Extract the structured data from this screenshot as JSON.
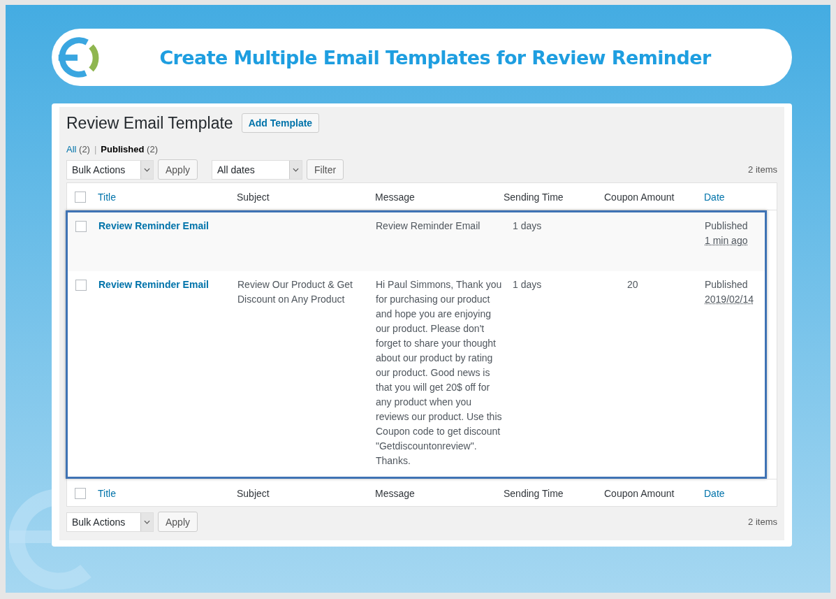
{
  "banner": {
    "title": "Create Multiple Email Templates for Review Reminder"
  },
  "page": {
    "heading": "Review Email Template",
    "add_button": "Add Template"
  },
  "views": [
    {
      "label": "All",
      "count": "(2)",
      "selected": false
    },
    {
      "label": "Published",
      "count": "(2)",
      "selected": true
    }
  ],
  "views_separator": "|",
  "top_nav": {
    "bulk_actions": "Bulk Actions",
    "apply": "Apply",
    "dates": "All dates",
    "filter": "Filter",
    "count": "2 items"
  },
  "table": {
    "rows_highlighted": true,
    "header_checked": false,
    "footer_checked": false,
    "columns": [
      {
        "label": "Title",
        "sortable": true
      },
      {
        "label": "Subject",
        "sortable": false
      },
      {
        "label": "Message",
        "sortable": false
      },
      {
        "label": "Sending Time",
        "sortable": false
      },
      {
        "label": "Coupon Amount",
        "sortable": false
      },
      {
        "label": "Date",
        "sortable": true
      }
    ],
    "rows": [
      {
        "checked": false,
        "title": "Review Reminder Email",
        "subject": "",
        "message": "Review Reminder Email",
        "sending_time": "1 days",
        "coupon_amount": "",
        "status": "Published",
        "date": "1 min ago"
      },
      {
        "checked": false,
        "title": "Review Reminder Email",
        "subject": "Review Our Product & Get Discount on Any Product",
        "message": "Hi Paul Simmons, Thank you for purchasing our product and hope you are enjoying our product. Please don't forget to share your thought about our product by rating our product. Good news is that you will get 20$ off for any product when you reviews our product. Use this Coupon code to get discount \"Getdiscountonreview\". Thanks.",
        "sending_time": "1 days",
        "coupon_amount": "20",
        "status": "Published",
        "date": "2019/02/14"
      }
    ],
    "footer_columns": [
      {
        "label": "Title",
        "sortable": true
      },
      {
        "label": "Subject",
        "sortable": false
      },
      {
        "label": "Message",
        "sortable": false
      },
      {
        "label": "Sending Time",
        "sortable": false
      },
      {
        "label": "Coupon Amount",
        "sortable": false
      },
      {
        "label": "Date",
        "sortable": true
      }
    ]
  },
  "bottom_nav": {
    "bulk_actions": "Bulk Actions",
    "apply": "Apply",
    "count": "2 items"
  }
}
